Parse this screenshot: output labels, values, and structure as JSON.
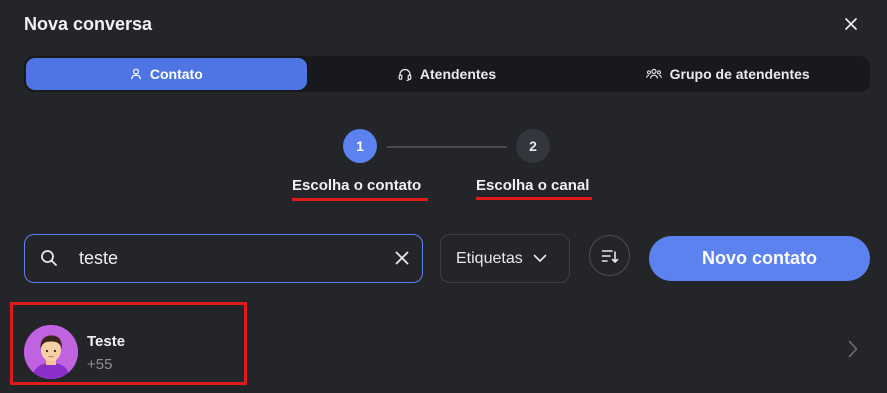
{
  "dialog": {
    "title": "Nova conversa"
  },
  "tabs": [
    {
      "label": "Contato",
      "icon": "person-icon",
      "active": true
    },
    {
      "label": "Atendentes",
      "icon": "headset-icon",
      "active": false
    },
    {
      "label": "Grupo de atendentes",
      "icon": "group-icon",
      "active": false
    }
  ],
  "steps": [
    {
      "number": "1",
      "label": "Escolha o contato",
      "active": true
    },
    {
      "number": "2",
      "label": "Escolha o canal",
      "active": false
    }
  ],
  "search": {
    "value": "teste",
    "icon": "search-icon",
    "clear_icon": "close-icon"
  },
  "filters": {
    "tags_label": "Etiquetas",
    "sort_icon": "sort-icon"
  },
  "actions": {
    "new_contact_label": "Novo contato"
  },
  "contacts": [
    {
      "name": "Teste",
      "phone": "+55",
      "avatar": "avatar-icon"
    }
  ],
  "colors": {
    "accent": "#5b82ee",
    "tab_active": "#4f74e3",
    "background": "#232529",
    "highlight": "#e01a1a"
  }
}
